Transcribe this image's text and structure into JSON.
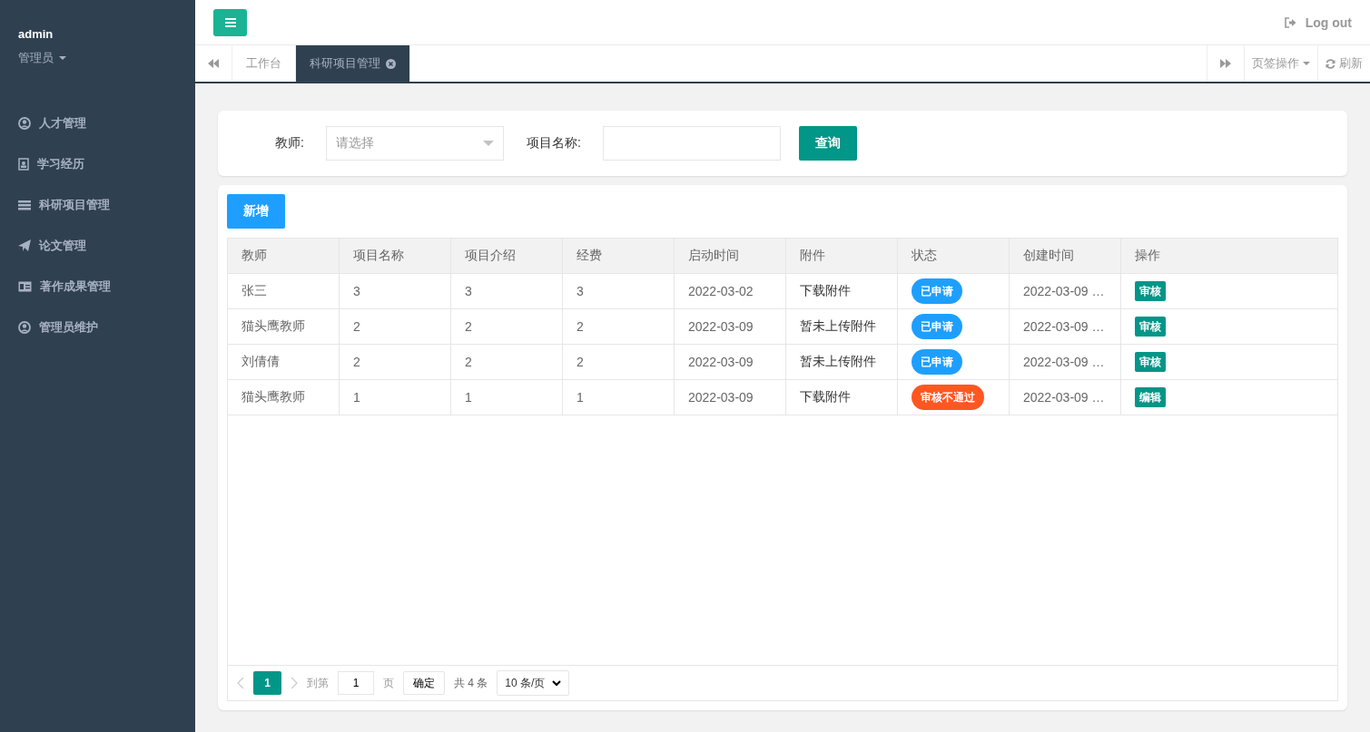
{
  "sidebar": {
    "user": "admin",
    "role": "管理员",
    "items": [
      {
        "label": "人才管理"
      },
      {
        "label": "学习经历"
      },
      {
        "label": "科研项目管理"
      },
      {
        "label": "论文管理"
      },
      {
        "label": "著作成果管理"
      },
      {
        "label": "管理员维护"
      }
    ]
  },
  "header": {
    "logout": "Log out"
  },
  "tabs": [
    {
      "label": "工作台",
      "selected": false
    },
    {
      "label": "科研项目管理",
      "selected": true
    }
  ],
  "tab_actions": {
    "operations": "页签操作",
    "refresh": "刷新"
  },
  "search": {
    "teacher_label": "教师:",
    "teacher_placeholder": "请选择",
    "project_label": "项目名称:",
    "query_button": "查询"
  },
  "add_button": "新增",
  "table": {
    "columns": [
      "教师",
      "项目名称",
      "项目介绍",
      "经费",
      "启动时间",
      "附件",
      "状态",
      "创建时间",
      "操作"
    ],
    "rows": [
      {
        "teacher": "张三",
        "name": "3",
        "intro": "3",
        "funding": "3",
        "start": "2022-03-02",
        "attachment": "下载附件",
        "status": {
          "text": "已申请",
          "kind": "applied"
        },
        "created": "2022-03-09 …",
        "action": "审核"
      },
      {
        "teacher": "猫头鹰教师",
        "name": "2",
        "intro": "2",
        "funding": "2",
        "start": "2022-03-09",
        "attachment": "暂未上传附件",
        "status": {
          "text": "已申请",
          "kind": "applied"
        },
        "created": "2022-03-09 …",
        "action": "审核"
      },
      {
        "teacher": "刘倩倩",
        "name": "2",
        "intro": "2",
        "funding": "2",
        "start": "2022-03-09",
        "attachment": "暂未上传附件",
        "status": {
          "text": "已申请",
          "kind": "applied"
        },
        "created": "2022-03-09 …",
        "action": "审核"
      },
      {
        "teacher": "猫头鹰教师",
        "name": "1",
        "intro": "1",
        "funding": "1",
        "start": "2022-03-09",
        "attachment": "下载附件",
        "status": {
          "text": "审核不通过",
          "kind": "rejected"
        },
        "created": "2022-03-09 …",
        "action": "编辑"
      }
    ]
  },
  "pagination": {
    "pages": [
      {
        "label": "1",
        "selected": true
      }
    ],
    "goto_label": "到第",
    "goto_value": "1",
    "page_unit": "页",
    "confirm": "确定",
    "total": "共 4 条",
    "page_size": "10 条/页"
  }
}
